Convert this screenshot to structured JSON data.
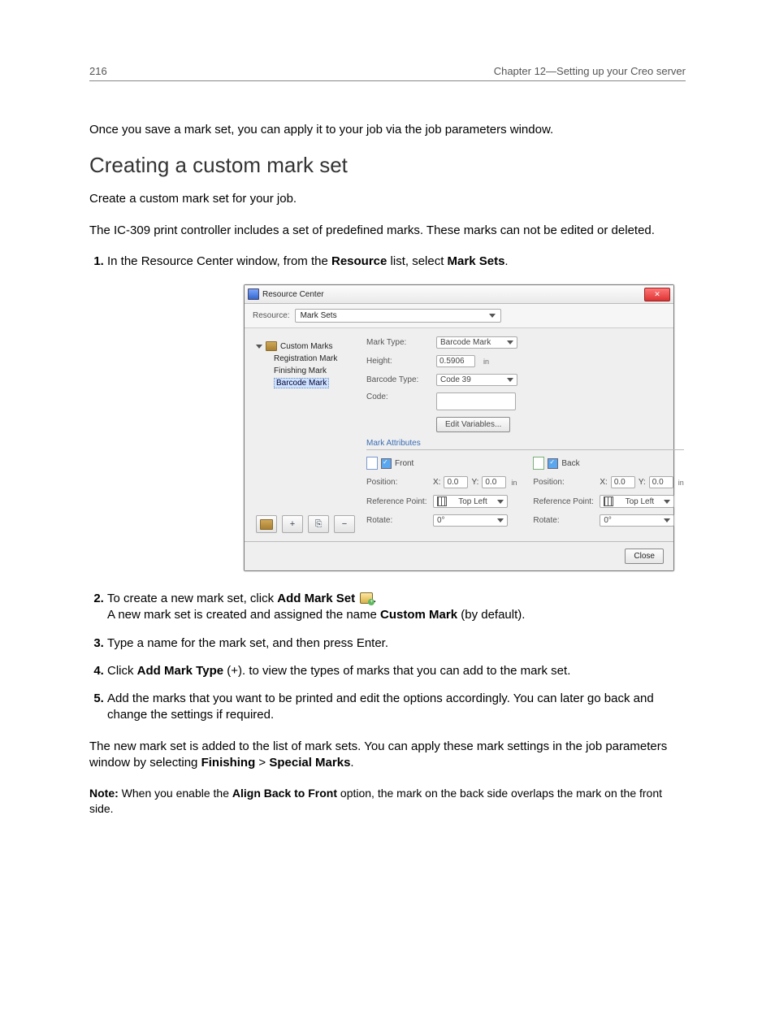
{
  "header": {
    "page_number": "216",
    "chapter": "Chapter 12—Setting up your Creo server"
  },
  "intro_para": "Once you save a mark set, you can apply it to your job via the job parameters window.",
  "section_title": "Creating a custom mark set",
  "lead_para": "Create a custom mark set for your job.",
  "pre_para": "The IC-309 print controller includes a set of predefined marks. These marks can not be edited or deleted.",
  "step1_a": "In the Resource Center window, from the ",
  "step1_b_bold": "Resource",
  "step1_c": " list, select ",
  "step1_d_bold": "Mark Sets",
  "step1_e": ".",
  "step2_a": "To create a new mark set, click ",
  "step2_b_bold": "Add Mark Set",
  "step2_d": ".",
  "step2_line2_a": "A new mark set is created and assigned the name ",
  "step2_line2_b_bold": "Custom Mark",
  "step2_line2_c": " (by default).",
  "step3": "Type a name for the mark set, and then press Enter.",
  "step4_a": "Click ",
  "step4_b_bold": "Add Mark Type",
  "step4_c": " (+). to view the types of marks that you can add to the mark set.",
  "step5": "Add the marks that you want to be printed and edit the options accordingly. You can later go back and change the settings if required.",
  "closing_a": "The new mark set is added to the list of mark sets. You can apply these mark settings in the job parameters window by selecting ",
  "closing_b_bold": "Finishing",
  "closing_c": " > ",
  "closing_d_bold": "Special Marks",
  "closing_e": ".",
  "note_label": "Note:",
  "note_a": " When you enable the ",
  "note_b_bold": "Align Back to Front",
  "note_c": " option, the mark on the back side overlaps the mark on the front side.",
  "dialog": {
    "title": "Resource Center",
    "resource_label": "Resource:",
    "resource_value": "Mark Sets",
    "tree_root": "Custom Marks",
    "tree_items": [
      "Registration Mark",
      "Finishing Mark",
      "Barcode Mark"
    ],
    "toolbar": {
      "add_set": "＋",
      "add_type": "+",
      "dup": "⎘",
      "del": "−"
    },
    "form": {
      "mark_type_label": "Mark Type:",
      "mark_type_value": "Barcode Mark",
      "height_label": "Height:",
      "height_value": "0.5906",
      "height_unit": "in",
      "barcode_type_label": "Barcode Type:",
      "barcode_type_value": "Code 39",
      "code_label": "Code:",
      "code_value": "",
      "edit_vars_btn": "Edit Variables..."
    },
    "attrs_label": "Mark Attributes",
    "front": {
      "head": "Front",
      "position_label": "Position:",
      "x_label": "X:",
      "x_value": "0.0",
      "y_label": "Y:",
      "y_value": "0.0",
      "unit": "in",
      "ref_label": "Reference Point:",
      "ref_value": "Top Left",
      "rotate_label": "Rotate:",
      "rotate_value": "0°"
    },
    "back": {
      "head": "Back",
      "position_label": "Position:",
      "x_label": "X:",
      "x_value": "0.0",
      "y_label": "Y:",
      "y_value": "0.0",
      "unit": "in",
      "ref_label": "Reference Point:",
      "ref_value": "Top Left",
      "rotate_label": "Rotate:",
      "rotate_value": "0°"
    },
    "close_btn": "Close"
  }
}
